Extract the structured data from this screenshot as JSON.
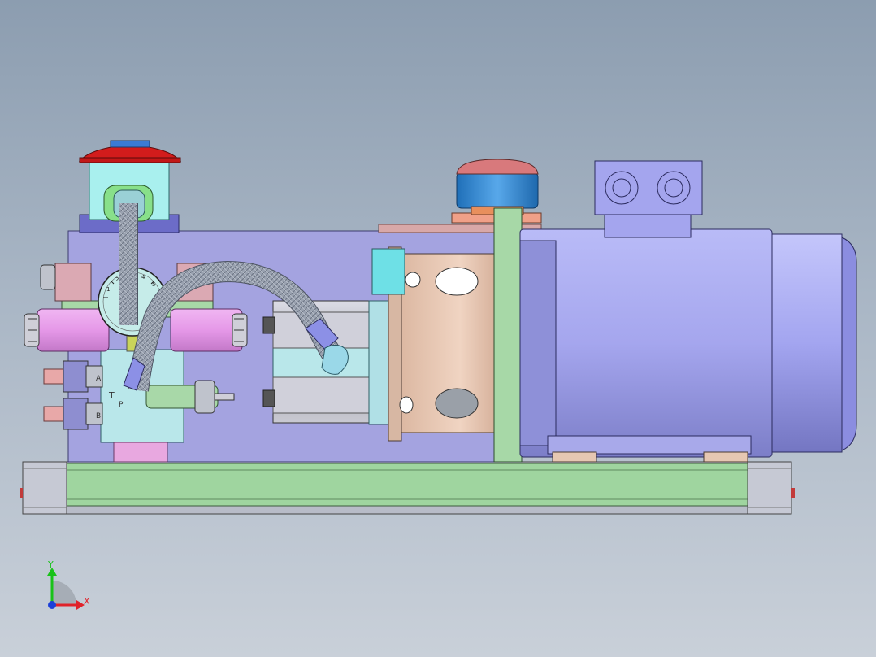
{
  "viewport": {
    "background_top": "#8c9db0",
    "background_bottom": "#c9d0d9"
  },
  "model": {
    "subject": "hydraulic-power-unit",
    "colors": {
      "tank": "#a4a3e0",
      "base_frame": "#9fd59f",
      "motor": "#a4a5ee",
      "motor_flange": "#e5c4b0",
      "filler_cap": "#d21c1c",
      "filter_body": "#a9f0ee",
      "breather": "#2f86cc",
      "valve_block": "#b9e7ea",
      "solenoid": "#e59ae9",
      "hose": "#8e98a8",
      "gauge_face": "#c6ece9"
    },
    "gauge": {
      "scale_labels": [
        "1",
        "2",
        "3",
        "4",
        "5"
      ]
    },
    "valve_markings": [
      "T",
      "A",
      "B",
      "P"
    ]
  },
  "triad": {
    "x_label": "X",
    "y_label": "Y",
    "x_color": "#e0222a",
    "y_color": "#19c219",
    "z_color": "#1b3fd8"
  }
}
